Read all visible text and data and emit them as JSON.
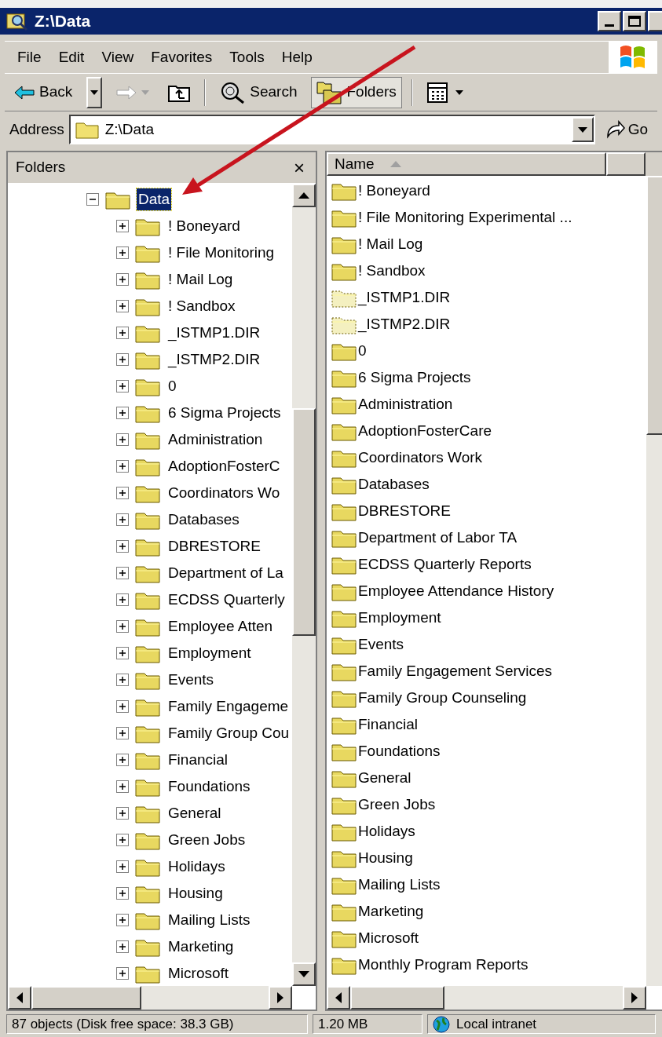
{
  "window": {
    "title": "Z:\\Data"
  },
  "menu": [
    "File",
    "Edit",
    "View",
    "Favorites",
    "Tools",
    "Help"
  ],
  "toolbar": [
    {
      "kind": "back",
      "label": "Back",
      "disabled": false,
      "selected": false
    },
    {
      "kind": "forward",
      "disabled": true,
      "selected": false
    },
    {
      "kind": "up",
      "disabled": false,
      "selected": false
    },
    {
      "kind": "search",
      "label": "Search",
      "disabled": false,
      "selected": false
    },
    {
      "kind": "folders",
      "label": "Folders",
      "disabled": false,
      "selected": true
    },
    {
      "kind": "views",
      "disabled": false,
      "selected": false
    }
  ],
  "address": {
    "label": "Address",
    "value": "Z:\\Data",
    "go": "Go"
  },
  "folders_pane": {
    "title": "Folders",
    "close": "×",
    "tree": [
      {
        "label": "Data",
        "expanded": true,
        "selected": true,
        "children": [
          {
            "label": "! Boneyard",
            "expanded": false,
            "selected": false
          },
          {
            "label": "! File Monitoring",
            "expanded": false,
            "selected": false
          },
          {
            "label": "! Mail Log",
            "expanded": false,
            "selected": false
          },
          {
            "label": "! Sandbox",
            "expanded": false,
            "selected": false
          },
          {
            "label": "_ISTMP1.DIR",
            "expanded": false,
            "selected": false
          },
          {
            "label": "_ISTMP2.DIR",
            "expanded": false,
            "selected": false
          },
          {
            "label": "0",
            "expanded": false,
            "selected": false
          },
          {
            "label": "6 Sigma Projects",
            "expanded": false,
            "selected": false
          },
          {
            "label": "Administration",
            "expanded": false,
            "selected": false
          },
          {
            "label": "AdoptionFosterC",
            "expanded": false,
            "selected": false
          },
          {
            "label": "Coordinators Wo",
            "expanded": false,
            "selected": false
          },
          {
            "label": "Databases",
            "expanded": false,
            "selected": false
          },
          {
            "label": "DBRESTORE",
            "expanded": false,
            "selected": false
          },
          {
            "label": "Department of La",
            "expanded": false,
            "selected": false
          },
          {
            "label": "ECDSS Quarterly",
            "expanded": false,
            "selected": false
          },
          {
            "label": "Employee Atten",
            "expanded": false,
            "selected": false
          },
          {
            "label": "Employment",
            "expanded": false,
            "selected": false
          },
          {
            "label": "Events",
            "expanded": false,
            "selected": false
          },
          {
            "label": "Family Engageme",
            "expanded": false,
            "selected": false
          },
          {
            "label": "Family Group Cou",
            "expanded": false,
            "selected": false
          },
          {
            "label": "Financial",
            "expanded": false,
            "selected": false
          },
          {
            "label": "Foundations",
            "expanded": false,
            "selected": false
          },
          {
            "label": "General",
            "expanded": false,
            "selected": false
          },
          {
            "label": "Green Jobs",
            "expanded": false,
            "selected": false
          },
          {
            "label": "Holidays",
            "expanded": false,
            "selected": false
          },
          {
            "label": "Housing",
            "expanded": false,
            "selected": false
          },
          {
            "label": "Mailing Lists",
            "expanded": false,
            "selected": false
          },
          {
            "label": "Marketing",
            "expanded": false,
            "selected": false
          },
          {
            "label": "Microsoft",
            "expanded": false,
            "selected": false
          }
        ]
      }
    ]
  },
  "file_list": {
    "columns": [
      "Name"
    ],
    "items": [
      {
        "name": "! Boneyard",
        "hidden": false
      },
      {
        "name": "! File Monitoring Experimental ...",
        "hidden": false
      },
      {
        "name": "! Mail Log",
        "hidden": false
      },
      {
        "name": "! Sandbox",
        "hidden": false
      },
      {
        "name": "_ISTMP1.DIR",
        "hidden": true
      },
      {
        "name": "_ISTMP2.DIR",
        "hidden": true
      },
      {
        "name": "0",
        "hidden": false
      },
      {
        "name": "6 Sigma Projects",
        "hidden": false
      },
      {
        "name": "Administration",
        "hidden": false
      },
      {
        "name": "AdoptionFosterCare",
        "hidden": false
      },
      {
        "name": "Coordinators Work",
        "hidden": false
      },
      {
        "name": "Databases",
        "hidden": false
      },
      {
        "name": "DBRESTORE",
        "hidden": false
      },
      {
        "name": "Department of Labor TA",
        "hidden": false
      },
      {
        "name": "ECDSS Quarterly Reports",
        "hidden": false
      },
      {
        "name": "Employee Attendance History",
        "hidden": false
      },
      {
        "name": "Employment",
        "hidden": false
      },
      {
        "name": "Events",
        "hidden": false
      },
      {
        "name": "Family Engagement Services",
        "hidden": false
      },
      {
        "name": "Family Group Counseling",
        "hidden": false
      },
      {
        "name": "Financial",
        "hidden": false
      },
      {
        "name": "Foundations",
        "hidden": false
      },
      {
        "name": "General",
        "hidden": false
      },
      {
        "name": "Green Jobs",
        "hidden": false
      },
      {
        "name": "Holidays",
        "hidden": false
      },
      {
        "name": "Housing",
        "hidden": false
      },
      {
        "name": "Mailing Lists",
        "hidden": false
      },
      {
        "name": "Marketing",
        "hidden": false
      },
      {
        "name": "Microsoft",
        "hidden": false
      },
      {
        "name": "Monthly Program Reports",
        "hidden": false
      }
    ]
  },
  "status_bar": [
    "87 objects (Disk free space: 38.3 GB)",
    "1.20 MB",
    "Local intranet"
  ]
}
